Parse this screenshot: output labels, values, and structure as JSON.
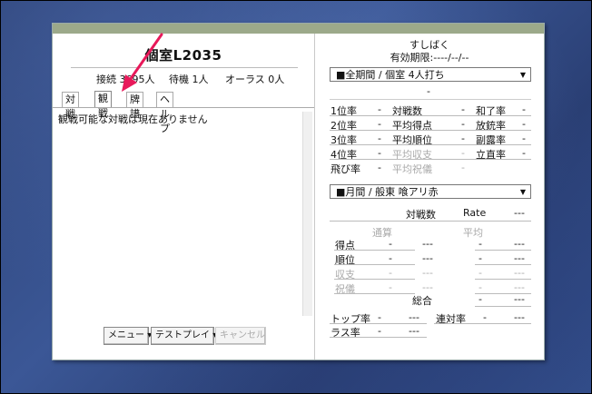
{
  "left": {
    "title": "個室L2035",
    "stats": {
      "connections": "接続 3695人",
      "waiting": "待機 1人",
      "all_last": "オーラス 0人"
    },
    "tabs": [
      "対戦",
      "観戦",
      "牌譜",
      "ヘルプ"
    ],
    "active_tab": 1,
    "message": "観戦可能な対戦は現在ありません",
    "buttons": {
      "menu": "メニュー",
      "test_play": "テストプレイ",
      "cancel": "キャンセル"
    }
  },
  "right": {
    "player_name": "すしばく",
    "expiry": "有効期限:----/--/--",
    "select1": "■全期間 / 個室 4人打ち",
    "dash_top": "-",
    "stats1": [
      {
        "label": "1位率",
        "value": "-",
        "grey": false
      },
      {
        "label": "2位率",
        "value": "-",
        "grey": false
      },
      {
        "label": "3位率",
        "value": "-",
        "grey": false
      },
      {
        "label": "4位率",
        "value": "-",
        "grey": false
      },
      {
        "label": "飛び率",
        "value": "-",
        "grey": false
      }
    ],
    "stats2": [
      {
        "label": "対戦数",
        "value": "-",
        "grey": false
      },
      {
        "label": "平均得点",
        "value": "-",
        "grey": false
      },
      {
        "label": "平均順位",
        "value": "-",
        "grey": false
      },
      {
        "label": "平均収支",
        "value": "-",
        "grey": true
      },
      {
        "label": "平均祝儀",
        "value": "-",
        "grey": true
      }
    ],
    "stats3": [
      {
        "label": "和了率",
        "value": "-"
      },
      {
        "label": "放銃率",
        "value": "-"
      },
      {
        "label": "副露率",
        "value": "-"
      },
      {
        "label": "立直率",
        "value": "-"
      }
    ],
    "select2": "■月間 / 般東 喰アリ赤",
    "games_label": "対戦数",
    "rate_label": "Rate",
    "rate_value": "---",
    "total_label": "通算",
    "avg_label": "平均",
    "rows": [
      {
        "label": "得点",
        "v1": "-",
        "v2": "---",
        "v3": "-",
        "v4": "---",
        "grey": false
      },
      {
        "label": "順位",
        "v1": "-",
        "v2": "---",
        "v3": "-",
        "v4": "---",
        "grey": false
      },
      {
        "label": "収支",
        "v1": "-",
        "v2": "---",
        "v3": "-",
        "v4": "---",
        "grey": true
      },
      {
        "label": "祝儀",
        "v1": "-",
        "v2": "---",
        "v3": "-",
        "v4": "---",
        "grey": true
      }
    ],
    "overall_label": "総合",
    "overall_v1": "-",
    "overall_v2": "---",
    "top_rate_label": "トップ率",
    "top_rate_v1": "-",
    "top_rate_v2": "---",
    "streak_label": "連対率",
    "streak_v1": "-",
    "streak_v2": "---",
    "last_rate_label": "ラス率",
    "last_rate_v1": "-",
    "last_rate_v2": "---"
  },
  "colors": {
    "annotation_arrow": "#e8195a",
    "top_bar": "#9ca98a"
  },
  "icons": {
    "dropdown": "dropdown-arrow-icon",
    "annotation": "pointer-arrow-icon"
  }
}
